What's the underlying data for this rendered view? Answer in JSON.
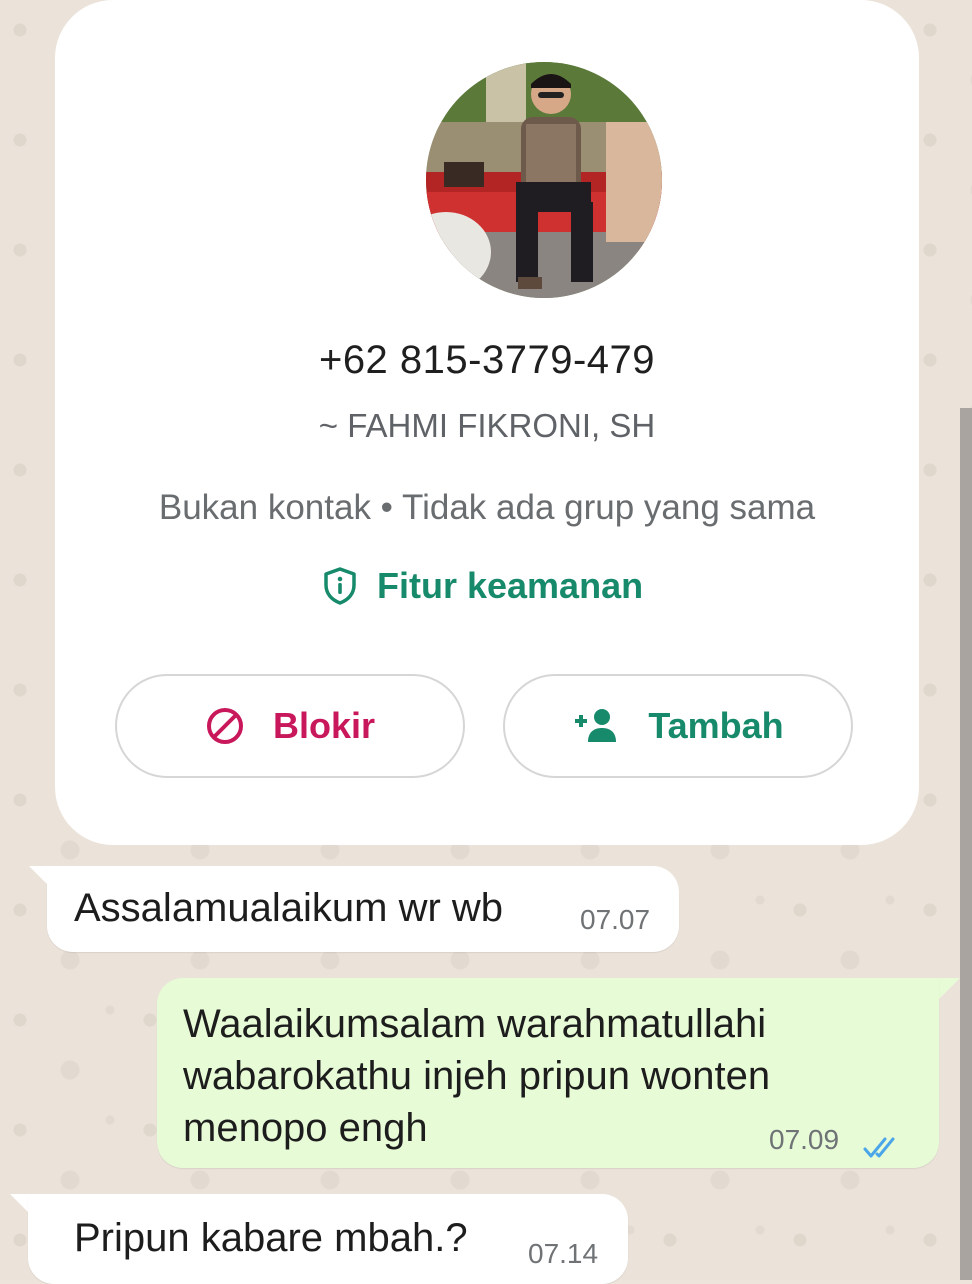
{
  "contact_card": {
    "phone": "+62 815-3779-479",
    "push_name": "~ FAHMI FIKRONI, SH",
    "status": "Bukan kontak • Tidak ada grup yang sama",
    "security_link": "Fitur keamanan",
    "block_label": "Blokir",
    "add_label": "Tambah",
    "icons": {
      "security": "shield-info-icon",
      "block": "block-icon",
      "add": "add-person-icon"
    }
  },
  "messages": [
    {
      "direction": "incoming",
      "text": "Assalamualaikum wr wb",
      "time": "07.07"
    },
    {
      "direction": "outgoing",
      "text": "Waalaikumsalam warahmatullahi\nwabarokathu injeh pripun wonten\nmenopo engh",
      "time": "07.09",
      "status_icon": "double-check-read-icon"
    },
    {
      "direction": "incoming",
      "text": "Pripun kabare mbah.?",
      "time": "07.14"
    }
  ],
  "colors": {
    "accent_green": "#178a6b",
    "block_red": "#c8185b",
    "read_tick_blue": "#4aa6e8",
    "outgoing_bubble": "#e7fbd7",
    "chat_background": "#ebe3da"
  }
}
